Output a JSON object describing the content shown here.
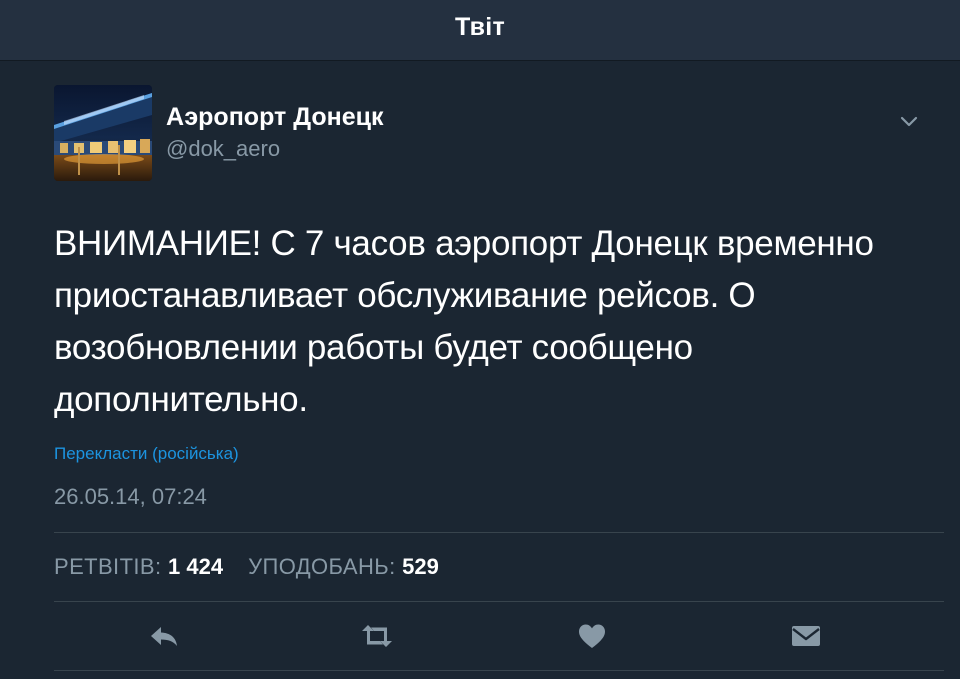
{
  "header": {
    "title": "Твіт"
  },
  "tweet": {
    "author_name": "Аэропорт Донецк",
    "author_handle": "@dok_aero",
    "text": "ВНИМАНИЕ! С 7 часов аэропорт Донецк временно приостанавливает обслуживание рейсов. О возобновлении работы будет сообщено дополнительно.",
    "translate_label": "Перекласти (російська)",
    "timestamp": "26.05.14, 07:24"
  },
  "stats": {
    "retweets_label": "РЕТВІТІВ:",
    "retweets_count": "1 424",
    "likes_label": "УПОДОБАНЬ:",
    "likes_count": "529"
  },
  "actions": [
    {
      "icon": "reply-icon"
    },
    {
      "icon": "retweet-icon"
    },
    {
      "icon": "heart-icon"
    },
    {
      "icon": "direct-message-icon"
    }
  ],
  "colors": {
    "background": "#1b2632",
    "header": "#243040",
    "secondary_text": "#8899a6",
    "link": "#1c94e0",
    "divider": "#38444d"
  }
}
